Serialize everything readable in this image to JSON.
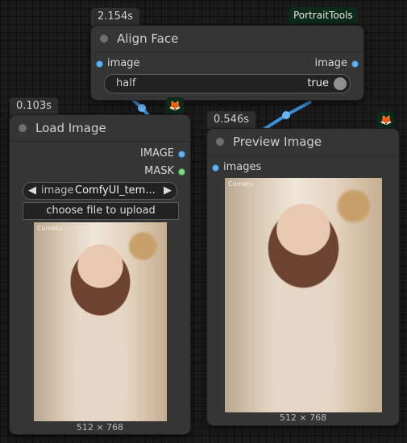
{
  "timings": {
    "align_face": "2.154s",
    "load_image": "0.103s",
    "preview_image": "0.546s"
  },
  "align_face": {
    "title": "Align Face",
    "group_tag": "PortraitTools",
    "input_label": "image",
    "output_label": "image",
    "widget_name": "half",
    "widget_value": "true"
  },
  "load_image": {
    "title": "Load Image",
    "outputs": [
      "IMAGE",
      "MASK"
    ],
    "combo_name": "image",
    "combo_value": "ComfyUI_tem...",
    "upload_label": "choose file to upload",
    "dimensions": "512 × 768",
    "watermark": "Cometu"
  },
  "preview_image": {
    "title": "Preview Image",
    "input_label": "images",
    "dimensions": "512 × 768",
    "watermark": "Cometu"
  },
  "icons": {
    "fox": "fox-icon",
    "left_arrow": "◀",
    "right_arrow": "▶"
  },
  "colors": {
    "link_blue": "#64b5f6",
    "link_green": "#7dd88a",
    "tag_green": "#0c2a17"
  }
}
